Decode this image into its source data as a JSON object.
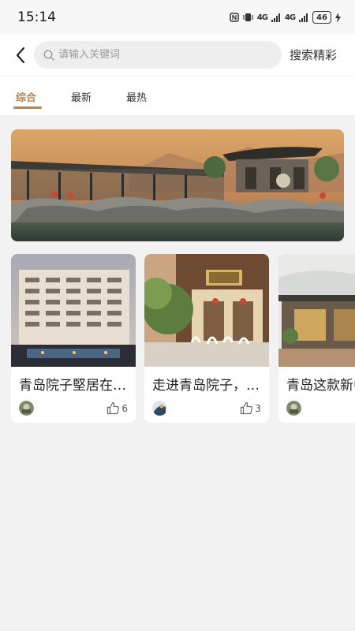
{
  "status_bar": {
    "time": "15:14",
    "signal1": "4G",
    "signal2": "4G",
    "battery": "46"
  },
  "header": {
    "search_placeholder": "请输入关键词",
    "search_action": "搜索精彩"
  },
  "tabs": [
    {
      "label": "综合",
      "active": true
    },
    {
      "label": "最新",
      "active": false
    },
    {
      "label": "最热",
      "active": false
    }
  ],
  "cards": [
    {
      "title": "青岛院子堅居在青岛",
      "likes": "6"
    },
    {
      "title": "走进青岛院子，感受",
      "likes": "3"
    },
    {
      "title": "青岛这款新中式",
      "likes": ""
    }
  ],
  "colors": {
    "accent": "#b5864a",
    "background": "#f2f2f2"
  }
}
